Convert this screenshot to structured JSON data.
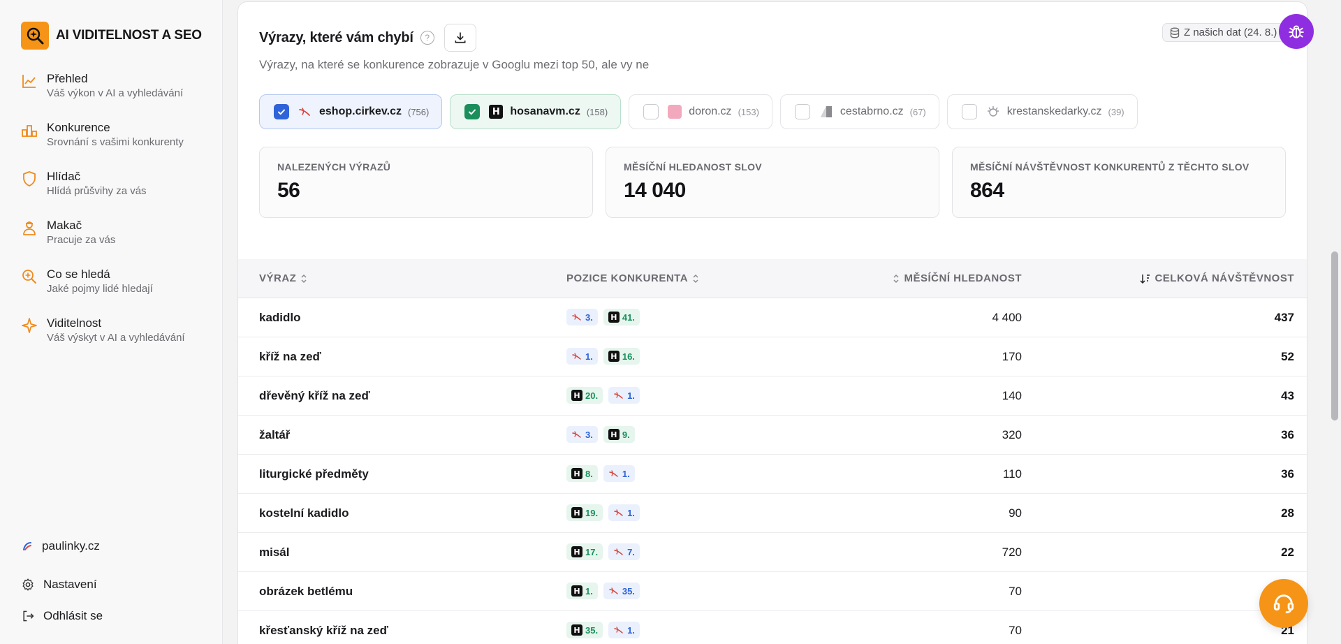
{
  "brand": {
    "title": "AI VIDITELNOST A SEO",
    "icon": "search-ai-logo"
  },
  "sidebar": {
    "items": [
      {
        "title": "Přehled",
        "subtitle": "Váš výkon v AI a vyhledávání",
        "icon": "chart-line-icon"
      },
      {
        "title": "Konkurence",
        "subtitle": "Srovnání s vašimi konkurenty",
        "icon": "podium-icon"
      },
      {
        "title": "Hlídač",
        "subtitle": "Hlídá průšvihy za vás",
        "icon": "shield-icon"
      },
      {
        "title": "Makač",
        "subtitle": "Pracuje za vás",
        "icon": "worker-icon"
      },
      {
        "title": "Co se hledá",
        "subtitle": "Jaké pojmy lidé hledají",
        "icon": "search-icon"
      },
      {
        "title": "Viditelnost",
        "subtitle": "Váš výskyt v AI a vyhledávání",
        "icon": "sparkle-icon"
      }
    ],
    "site": "paulinky.cz",
    "settings": "Nastavení",
    "logout": "Odhlásit se"
  },
  "section": {
    "title": "Výrazy, které vám chybí",
    "subtitle": "Výrazy, na které se konkurence zobrazuje v Googlu mezi top 50, ale vy ne",
    "source_badge": "Z našich dat (24. 8.)"
  },
  "competitors": [
    {
      "name": "eshop.cirkev.cz",
      "count": "(756)",
      "checked": true,
      "color": "#2e63d9"
    },
    {
      "name": "hosanavm.cz",
      "count": "(158)",
      "checked": true,
      "color": "#1a8f5c"
    },
    {
      "name": "doron.cz",
      "count": "(153)",
      "checked": false
    },
    {
      "name": "cestabrno.cz",
      "count": "(67)",
      "checked": false
    },
    {
      "name": "krestanskedarky.cz",
      "count": "(39)",
      "checked": false
    }
  ],
  "stats": [
    {
      "label": "Nalezených výrazů",
      "value": "56"
    },
    {
      "label": "Měsíční hledanost slov",
      "value": "14 040"
    },
    {
      "label": "Měsíční návštěvnost konkurentů z těchto slov",
      "value": "864"
    }
  ],
  "table": {
    "columns": {
      "phrase": "VÝRAZ",
      "position": "POZICE KONKURENTA",
      "search": "MĚSÍČNÍ HLEDANOST",
      "visits": "CELKOVÁ NÁVŠTĚVNOST"
    },
    "rows": [
      {
        "phrase": "kadidlo",
        "positions": [
          {
            "site": "eshop",
            "pos": "3."
          },
          {
            "site": "hosana",
            "pos": "41."
          }
        ],
        "search": "4 400",
        "visits": "437"
      },
      {
        "phrase": "kříž na zeď",
        "positions": [
          {
            "site": "eshop",
            "pos": "1."
          },
          {
            "site": "hosana",
            "pos": "16."
          }
        ],
        "search": "170",
        "visits": "52"
      },
      {
        "phrase": "dřevěný kříž na zeď",
        "positions": [
          {
            "site": "hosana",
            "pos": "20."
          },
          {
            "site": "eshop",
            "pos": "1."
          }
        ],
        "search": "140",
        "visits": "43"
      },
      {
        "phrase": "žaltář",
        "positions": [
          {
            "site": "eshop",
            "pos": "3."
          },
          {
            "site": "hosana",
            "pos": "9."
          }
        ],
        "search": "320",
        "visits": "36"
      },
      {
        "phrase": "liturgické předměty",
        "positions": [
          {
            "site": "hosana",
            "pos": "8."
          },
          {
            "site": "eshop",
            "pos": "1."
          }
        ],
        "search": "110",
        "visits": "36"
      },
      {
        "phrase": "kostelní kadidlo",
        "positions": [
          {
            "site": "hosana",
            "pos": "19."
          },
          {
            "site": "eshop",
            "pos": "1."
          }
        ],
        "search": "90",
        "visits": "28"
      },
      {
        "phrase": "misál",
        "positions": [
          {
            "site": "hosana",
            "pos": "17."
          },
          {
            "site": "eshop",
            "pos": "7."
          }
        ],
        "search": "720",
        "visits": "22"
      },
      {
        "phrase": "obrázek betlému",
        "positions": [
          {
            "site": "hosana",
            "pos": "1."
          },
          {
            "site": "eshop",
            "pos": "35."
          }
        ],
        "search": "70",
        "visits": ""
      },
      {
        "phrase": "křesťanský kříž na zeď",
        "positions": [
          {
            "site": "hosana",
            "pos": "35."
          },
          {
            "site": "eshop",
            "pos": "1."
          }
        ],
        "search": "70",
        "visits": "21"
      }
    ]
  }
}
